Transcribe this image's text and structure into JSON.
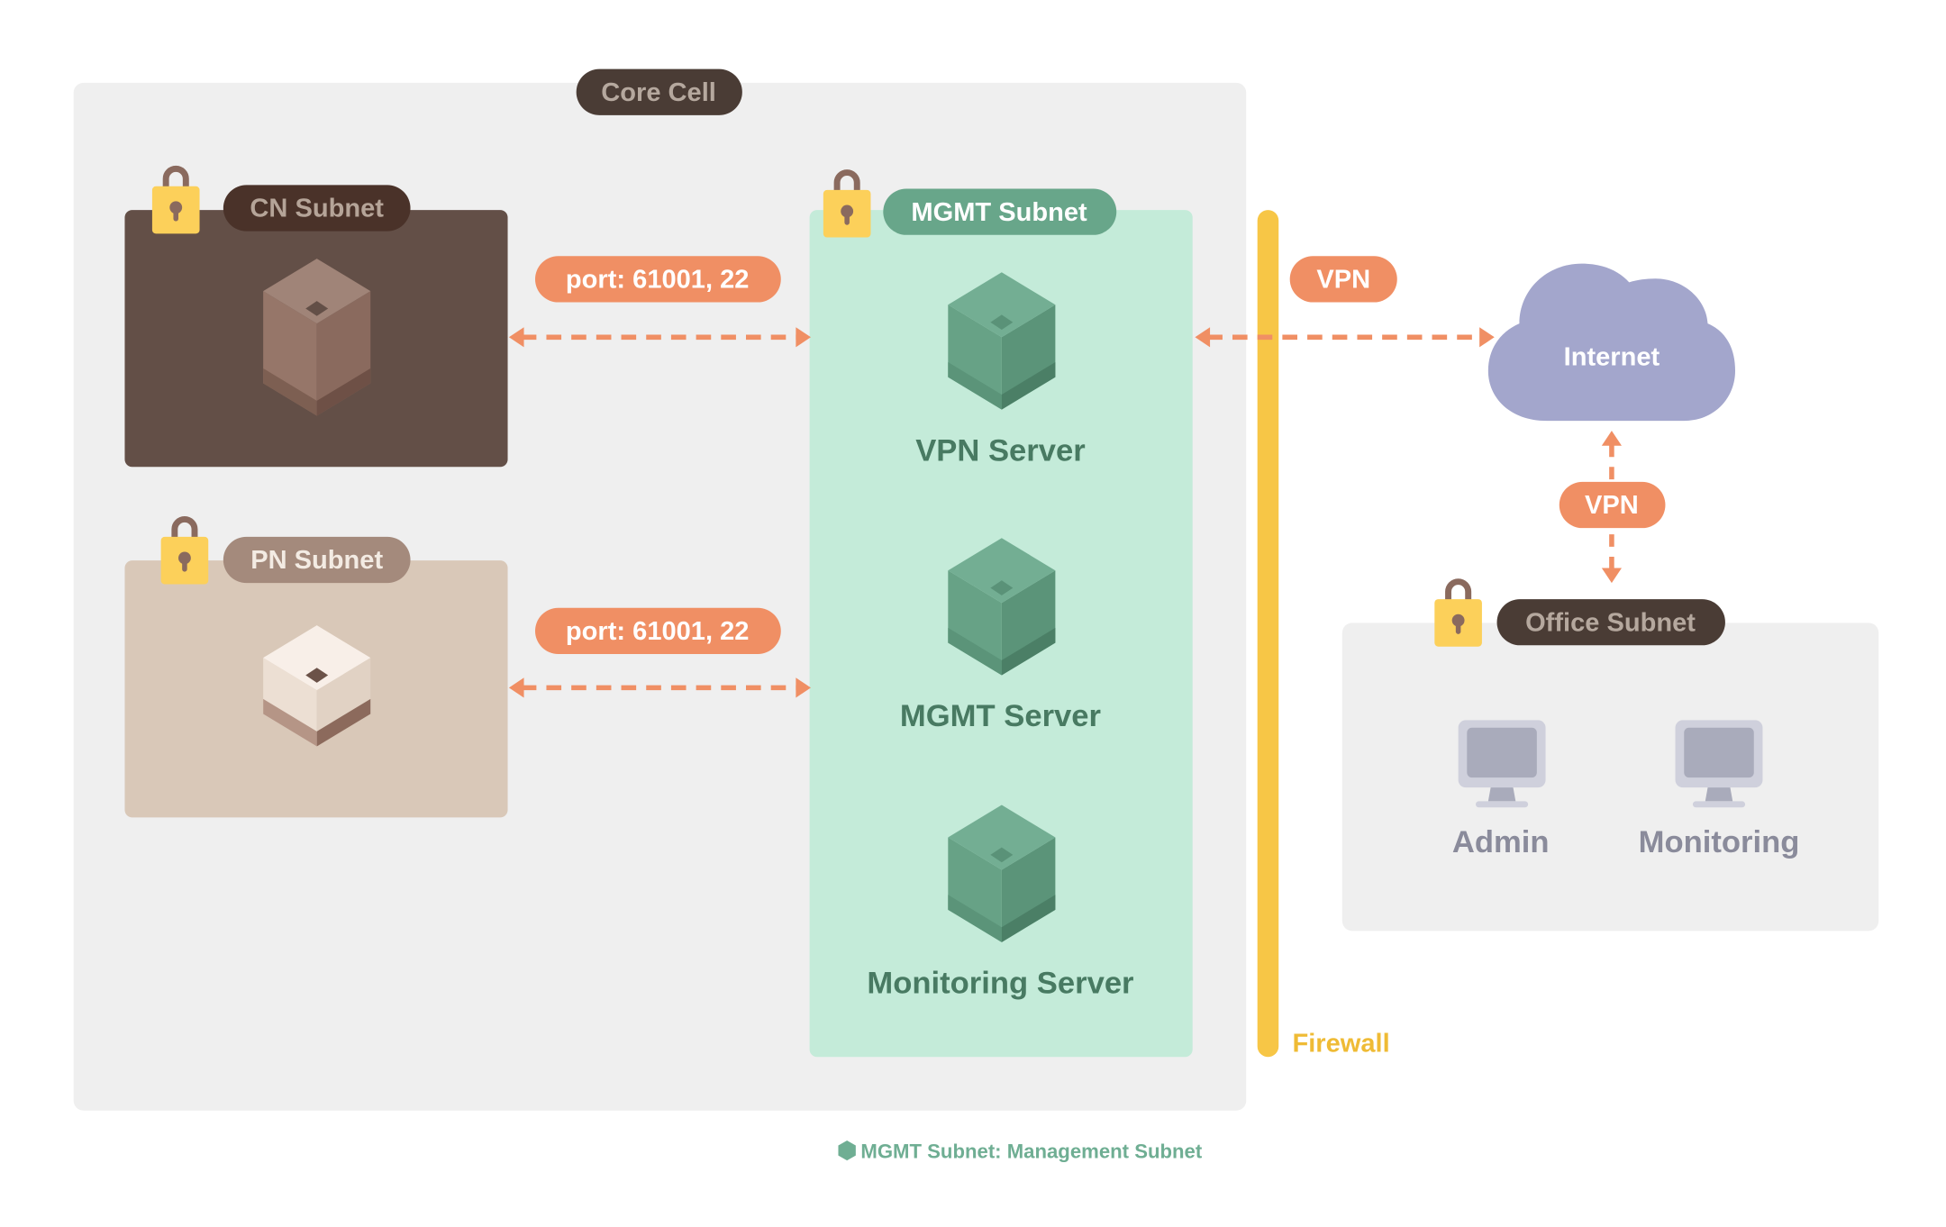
{
  "colors": {
    "core_bg": "#efefef",
    "label_dark": "#4a3c35",
    "label_dark_text": "#b5a89e",
    "cn_box": "#634f47",
    "cn_label": "#4a3229",
    "cn_label_text": "#b5a498",
    "pn_box": "#d9c8b8",
    "pn_label": "#a48a7c",
    "pn_label_text": "#f3ebe3",
    "mgmt_box": "#c4ebd9",
    "mgmt_label": "#68a68a",
    "server_text": "#487a62",
    "accent_orange": "#f08f64",
    "firewall": "#f7c646",
    "firewall_text": "#efbb35",
    "cloud": "#a3a6cc",
    "office_bg": "#efefef",
    "pc_text": "#8a8b9b",
    "lock_body": "#fcd05a",
    "lock_shackle": "#8a6a5e",
    "legend_text": "#6fae93"
  },
  "core_cell": {
    "label": "Core Cell"
  },
  "cn_subnet": {
    "label": "CN Subnet",
    "icon": "lock-icon"
  },
  "pn_subnet": {
    "label": "PN Subnet",
    "icon": "lock-icon"
  },
  "mgmt_subnet": {
    "label": "MGMT Subnet",
    "icon": "lock-icon",
    "servers": [
      {
        "label": "VPN Server"
      },
      {
        "label": "MGMT Server"
      },
      {
        "label": "Monitoring Server"
      }
    ]
  },
  "connections": {
    "cn_port": "port:  61001, 22",
    "pn_port": "port:  61001, 22",
    "vpn_internet": "VPN",
    "vpn_office": "VPN"
  },
  "firewall": {
    "label": "Firewall"
  },
  "internet": {
    "label": "Internet"
  },
  "office_subnet": {
    "label": "Office Subnet",
    "icon": "lock-icon",
    "computers": [
      {
        "label": "Admin"
      },
      {
        "label": "Monitoring"
      }
    ]
  },
  "legend": {
    "text": "MGMT Subnet: Management Subnet"
  }
}
